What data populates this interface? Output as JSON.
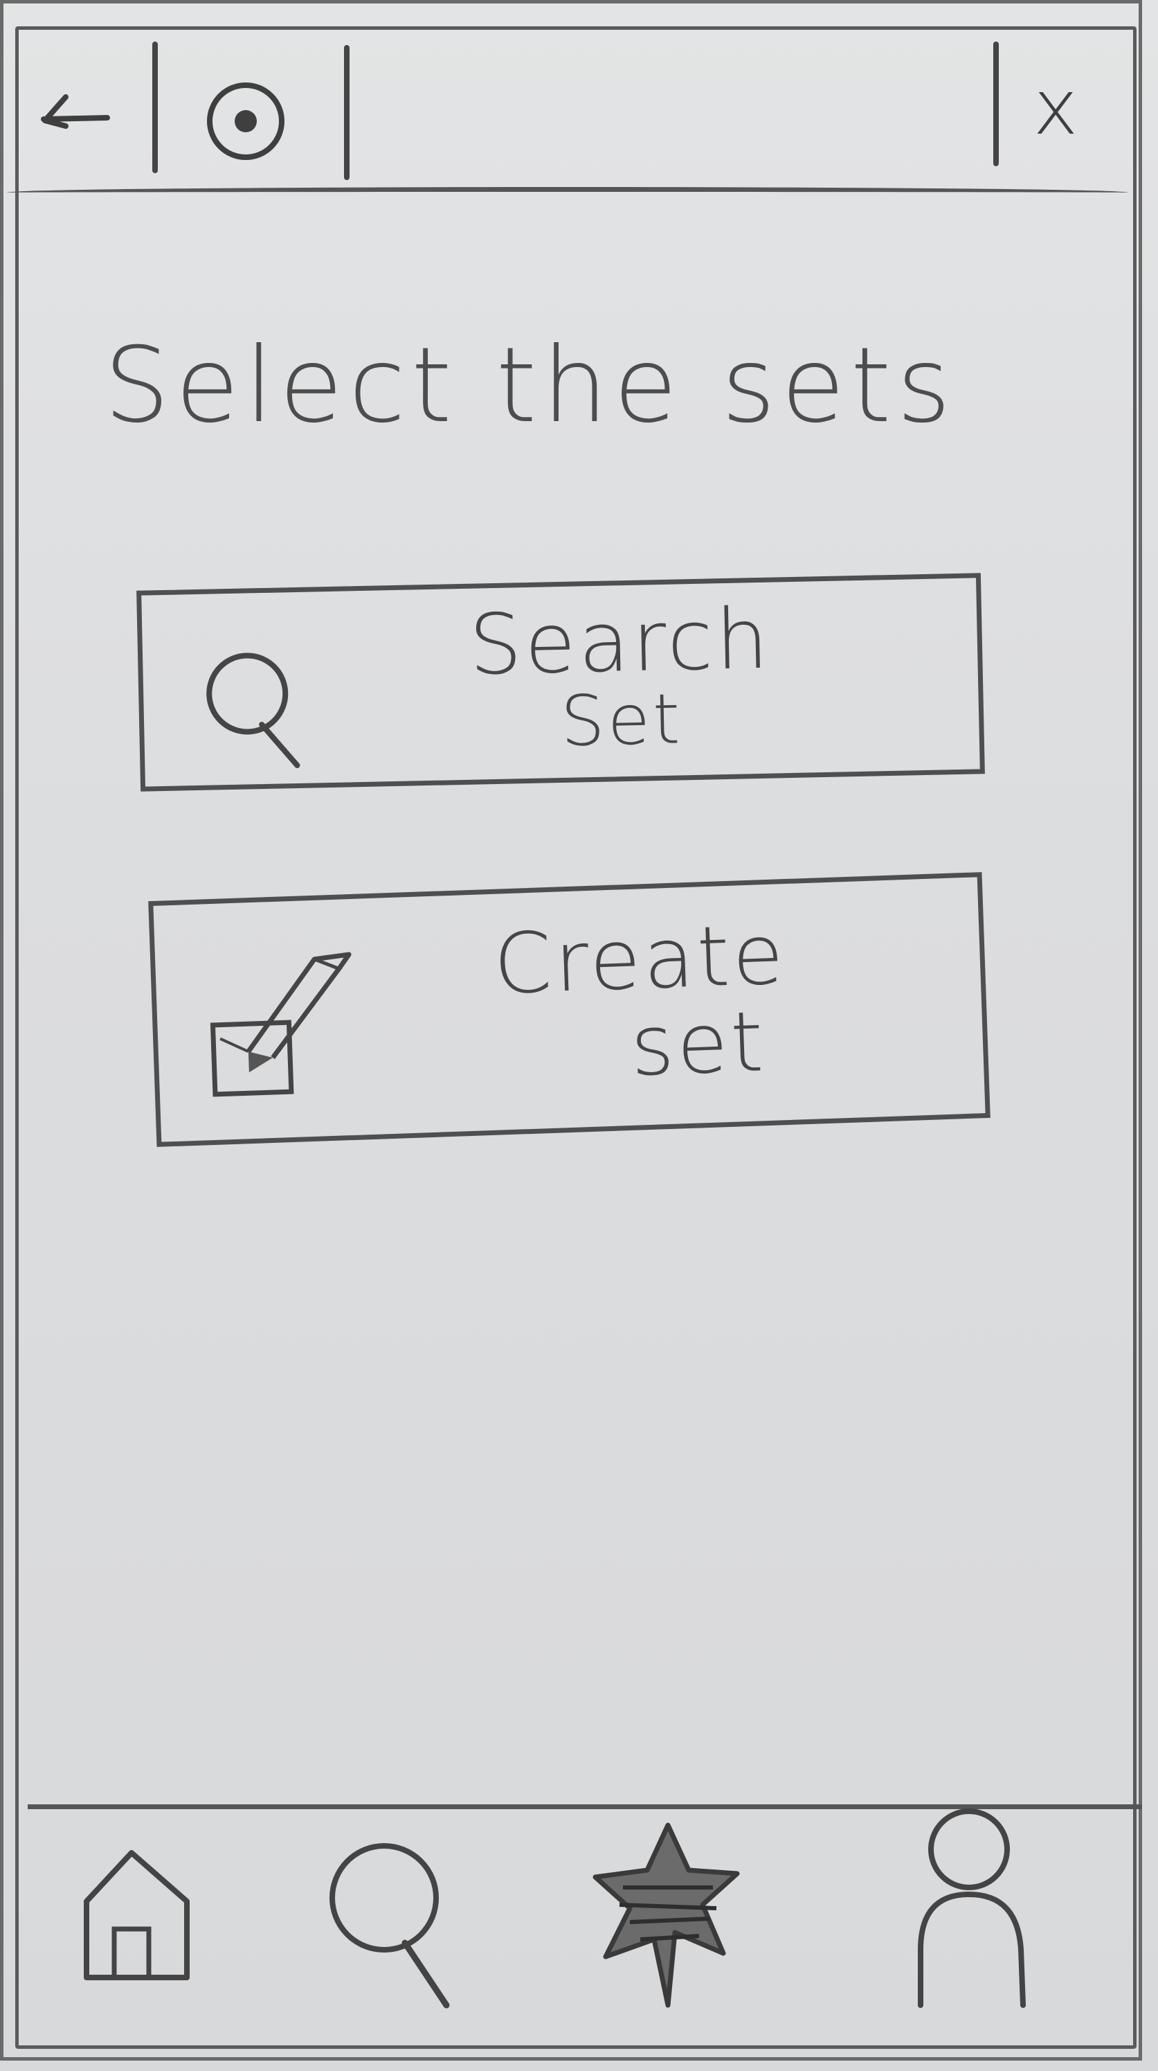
{
  "topbar": {
    "back_icon": "back-arrow-icon",
    "target_icon": "target-icon",
    "close_label": "x"
  },
  "heading": "Select the sets",
  "actions": [
    {
      "label_line1": "Search",
      "label_line2": "Set",
      "icon": "search-icon"
    },
    {
      "label_line1": "Create",
      "label_line2": "set",
      "icon": "edit-box-icon"
    }
  ],
  "bottom_nav": [
    {
      "icon": "home-icon"
    },
    {
      "icon": "search-icon"
    },
    {
      "icon": "star-icon"
    },
    {
      "icon": "profile-icon"
    }
  ]
}
